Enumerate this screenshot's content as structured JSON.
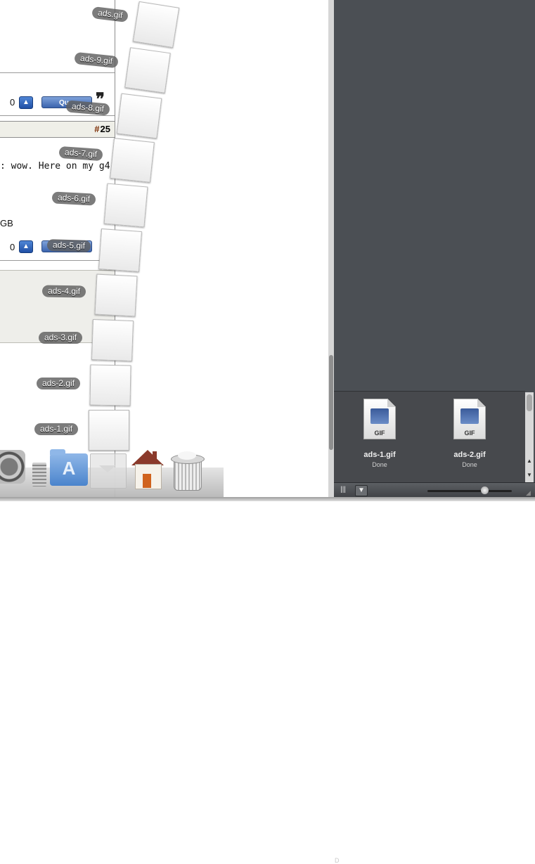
{
  "forum": {
    "post_number_hash": "#",
    "post_number": "25",
    "snippet_text": ": wow. Here on my g4",
    "sig_text": "GB",
    "apple_glyph": "",
    "vote_count_1": "0",
    "vote_count_2": "0",
    "quote_button_label": "Qu",
    "quote_mark": "❞"
  },
  "dock_stack": {
    "items": [
      {
        "label": "ads.gif"
      },
      {
        "label": "ads-9.gif"
      },
      {
        "label": "ads-8.gif"
      },
      {
        "label": "ads-7.gif"
      },
      {
        "label": "ads-6.gif"
      },
      {
        "label": "ads-5.gif"
      },
      {
        "label": "ads-4.gif"
      },
      {
        "label": "ads-3.gif"
      },
      {
        "label": "ads-2.gif"
      },
      {
        "label": "ads-1.gif"
      }
    ]
  },
  "downloads_window": {
    "items": [
      {
        "name": "ads-1.gif",
        "status": "Done",
        "file_badge": "GIF"
      },
      {
        "name": "ads-2.gif",
        "status": "Done",
        "file_badge": "GIF"
      }
    ],
    "cut_off_left": "D",
    "toolbar": {
      "columns_glyph": "|||",
      "menu_glyph": "▼"
    }
  },
  "dock": {
    "icons": [
      "system-preferences-icon",
      "stack-icon",
      "applications-folder-icon",
      "downloads-stack-icon",
      "home-icon",
      "trash-icon"
    ]
  }
}
